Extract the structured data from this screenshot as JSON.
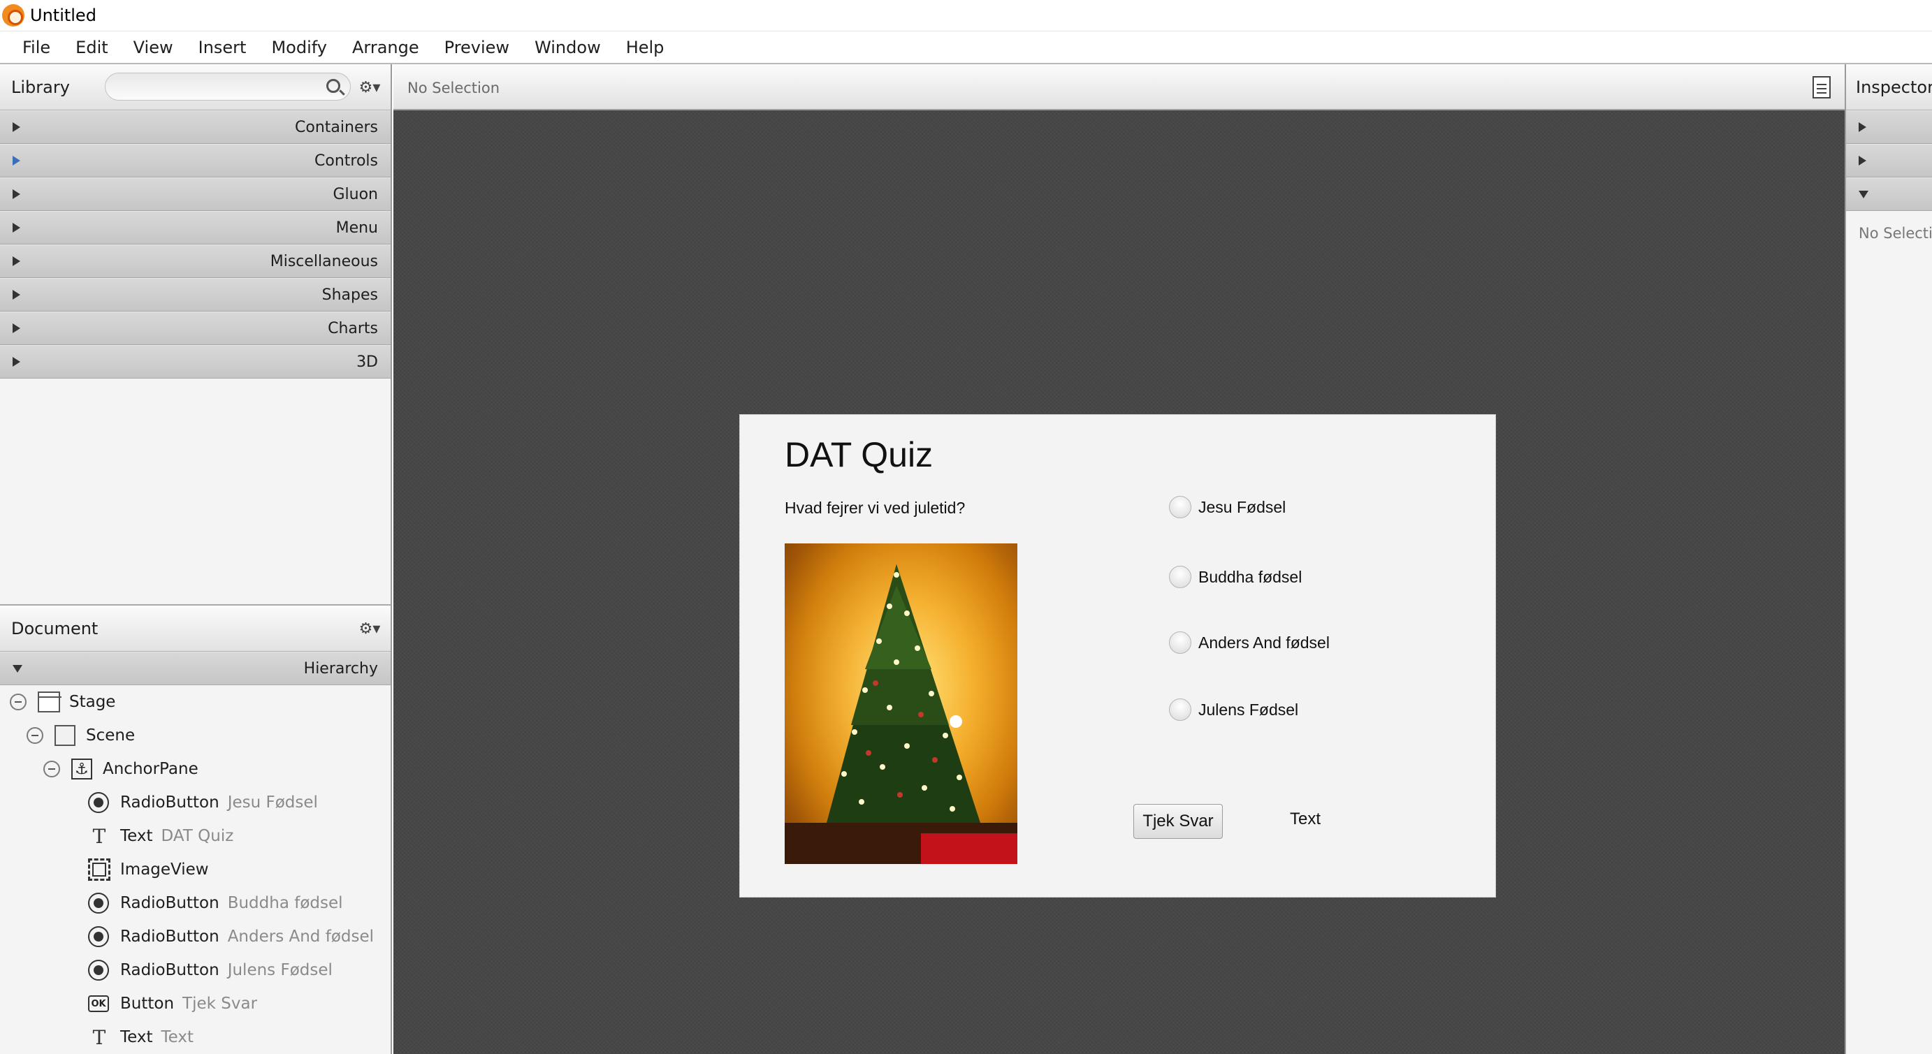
{
  "window": {
    "title": "Untitled"
  },
  "menubar": [
    "File",
    "Edit",
    "View",
    "Insert",
    "Modify",
    "Arrange",
    "Preview",
    "Window",
    "Help"
  ],
  "library": {
    "title": "Library",
    "search_placeholder": "",
    "sections": [
      "Containers",
      "Controls",
      "Gluon",
      "Menu",
      "Miscellaneous",
      "Shapes",
      "Charts",
      "3D"
    ],
    "active_section": "Controls"
  },
  "document": {
    "title": "Document",
    "section": "Hierarchy",
    "tree": [
      {
        "type": "Stage",
        "value": "",
        "icon": "stage-icon"
      },
      {
        "type": "Scene",
        "value": "",
        "icon": "scene-icon"
      },
      {
        "type": "AnchorPane",
        "value": "",
        "icon": "anchorpane-icon"
      },
      {
        "type": "RadioButton",
        "value": "Jesu Fødsel",
        "icon": "radiobutton-icon"
      },
      {
        "type": "Text",
        "value": "DAT Quiz",
        "icon": "text-icon"
      },
      {
        "type": "ImageView",
        "value": "",
        "icon": "imageview-icon"
      },
      {
        "type": "RadioButton",
        "value": "Buddha fødsel",
        "icon": "radiobutton-icon"
      },
      {
        "type": "RadioButton",
        "value": "Anders And fødsel",
        "icon": "radiobutton-icon"
      },
      {
        "type": "RadioButton",
        "value": "Julens Fødsel",
        "icon": "radiobutton-icon"
      },
      {
        "type": "Button",
        "value": "Tjek Svar",
        "icon": "button-icon"
      },
      {
        "type": "Text",
        "value": "Text",
        "icon": "text-icon"
      }
    ]
  },
  "center": {
    "selection": "No Selection"
  },
  "quiz": {
    "title": "DAT Quiz",
    "question": "Hvad fejrer vi ved juletid?",
    "options": [
      "Jesu Fødsel",
      "Buddha fødsel",
      "Anders And fødsel",
      "Julens Fødsel"
    ],
    "button_label": "Tjek Svar",
    "result_text": "Text"
  },
  "inspector": {
    "title": "Inspector",
    "selection": "No Selection"
  }
}
